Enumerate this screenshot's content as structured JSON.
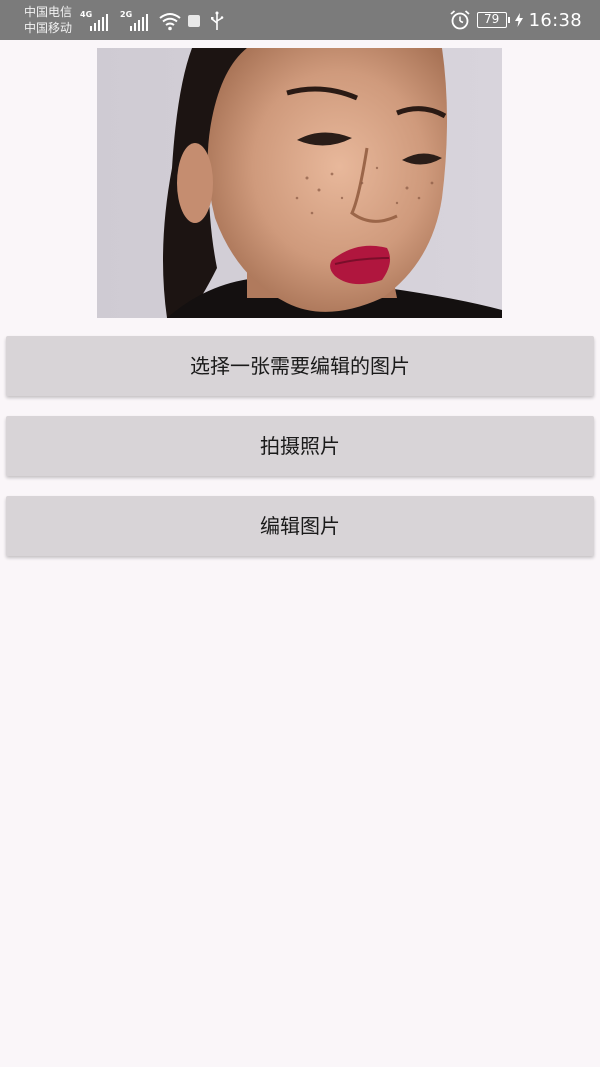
{
  "status_bar": {
    "carrier_1": "中国电信",
    "carrier_2": "中国移动",
    "network_1": "4G",
    "network_2": "2G",
    "battery": "79",
    "time": "16:38",
    "icons": [
      "signal-icon",
      "wifi-icon",
      "notification-square-icon",
      "usb-icon",
      "alarm-icon",
      "battery-icon",
      "charging-icon"
    ]
  },
  "main": {
    "buttons": {
      "select_image": "选择一张需要编辑的图片",
      "take_photo": "拍摄照片",
      "edit_image": "编辑图片"
    }
  }
}
